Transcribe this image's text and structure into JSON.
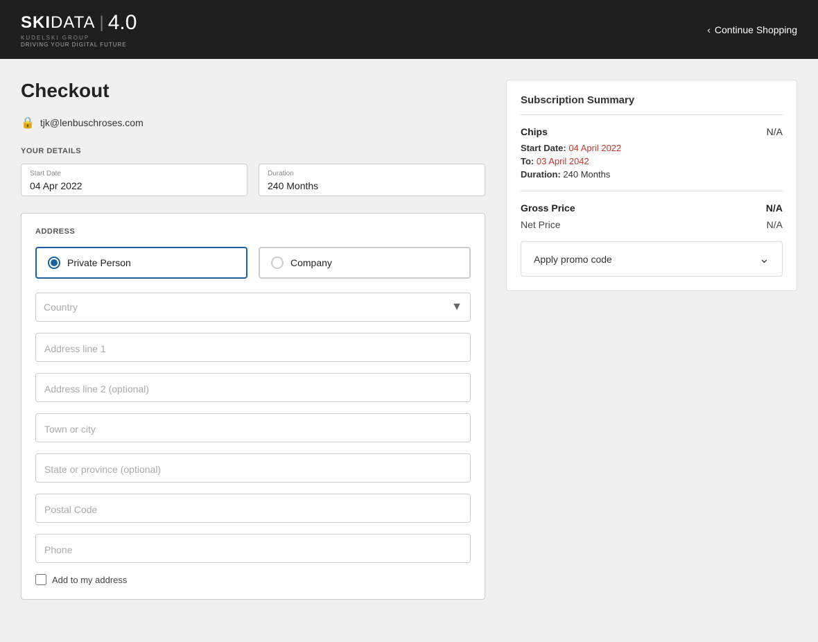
{
  "header": {
    "logo_ski": "SKI",
    "logo_data": "DATA",
    "logo_sep": "|",
    "logo_version": "4.0",
    "logo_kudelski": "KUDELSKI GROUP",
    "logo_driving": "DRIVING YOUR DIGITAL FUTURE",
    "continue_shopping": "Continue Shopping"
  },
  "checkout": {
    "title": "Checkout",
    "email_icon": "🔒",
    "email": "tjk@lenbuschroses.com",
    "your_details_label": "YOUR DETAILS",
    "start_date_label": "Start Date",
    "start_date_value": "04 Apr 2022",
    "duration_label": "Duration",
    "duration_value": "240 Months",
    "address_section_label": "ADDRESS",
    "private_person_label": "Private Person",
    "company_label": "Company",
    "country_placeholder": "Country",
    "address_line1_placeholder": "Address line 1",
    "address_line2_placeholder": "Address line 2 (optional)",
    "town_placeholder": "Town or city",
    "state_placeholder": "State or province (optional)",
    "postal_placeholder": "Postal Code",
    "phone_placeholder": "Phone",
    "add_to_address_label": "Add to my address"
  },
  "summary": {
    "title": "Subscription Summary",
    "item_name": "Chips",
    "item_value": "N/A",
    "start_date_label": "Start Date:",
    "start_date_value": "04 April 2022",
    "to_label": "To:",
    "to_value": "03 April 2042",
    "duration_label": "Duration:",
    "duration_value": "240 Months",
    "gross_price_label": "Gross Price",
    "gross_price_value": "N/A",
    "net_price_label": "Net Price",
    "net_price_value": "N/A",
    "promo_label": "Apply promo code",
    "promo_chevron": "⌄"
  }
}
